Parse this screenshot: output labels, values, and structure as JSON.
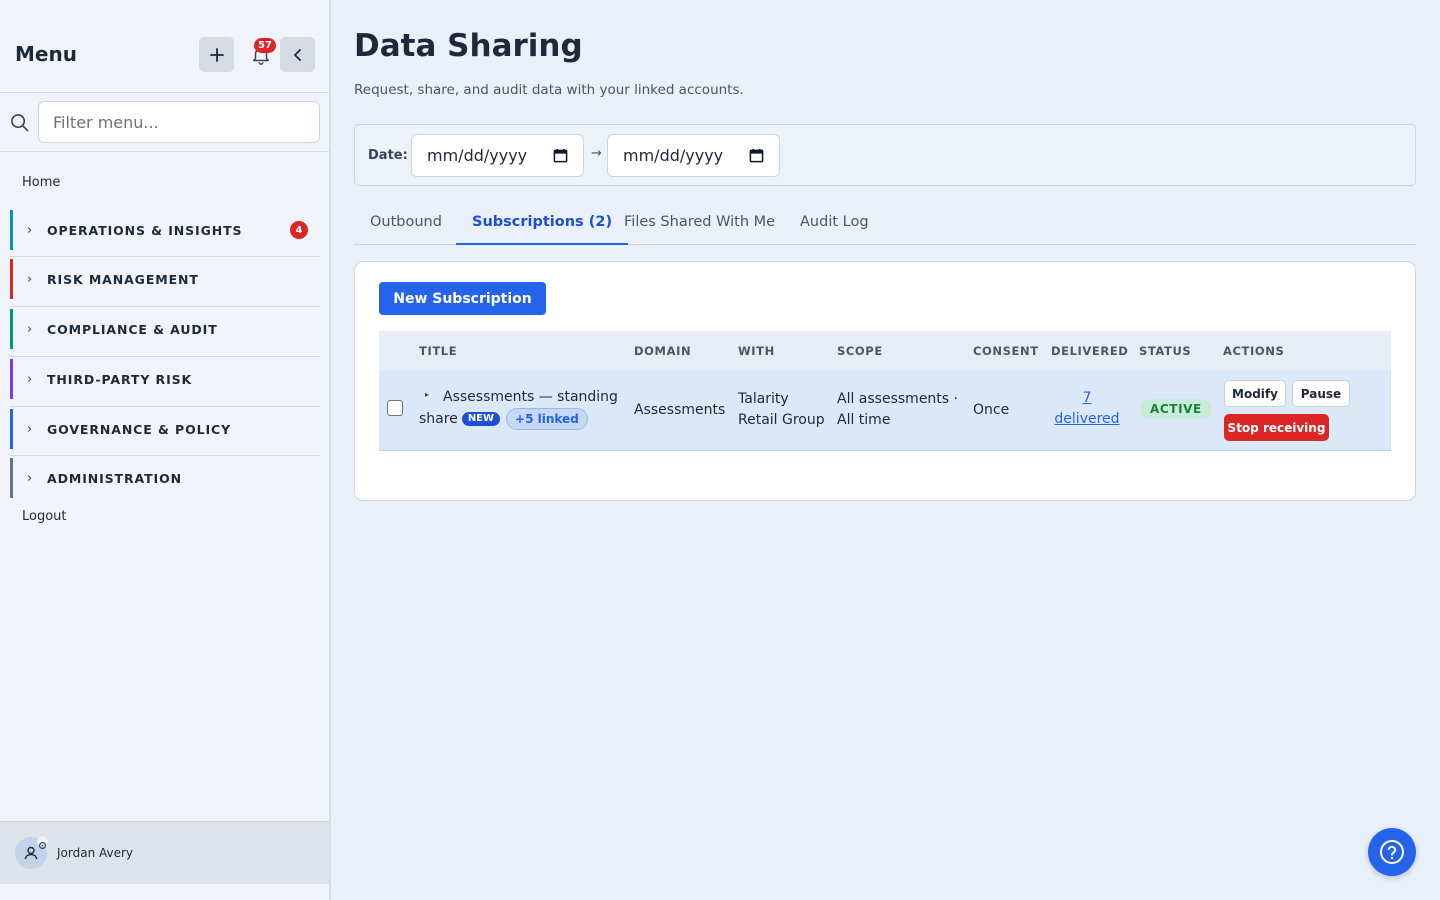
{
  "sidebar": {
    "title": "Menu",
    "notification_count": "57",
    "filter_placeholder": "Filter menu...",
    "home_label": "Home",
    "logout_label": "Logout",
    "sections": [
      {
        "label": "OPERATIONS & INSIGHTS",
        "count": "4",
        "color": "#0891b2"
      },
      {
        "label": "RISK MANAGEMENT",
        "color": "#dc2626"
      },
      {
        "label": "COMPLIANCE & AUDIT",
        "color": "#059669"
      },
      {
        "label": "THIRD-PARTY RISK",
        "color": "#7c3aed"
      },
      {
        "label": "GOVERNANCE & POLICY",
        "color": "#2563eb"
      },
      {
        "label": "ADMINISTRATION",
        "color": "#64748b"
      }
    ],
    "user_name": "Jordan Avery"
  },
  "main": {
    "title": "Data Sharing",
    "subtitle": "Request, share, and audit data with your linked accounts.",
    "filter": {
      "date_label": "Date:",
      "from_placeholder": "mm/dd/yyyy",
      "to_placeholder": "mm/dd/yyyy",
      "arrow": "→"
    },
    "tabs": [
      {
        "label": "Outbound"
      },
      {
        "label": "Subscriptions (2)"
      },
      {
        "label": "Files Shared With Me"
      },
      {
        "label": "Audit Log"
      }
    ],
    "new_button_label": "New Subscription",
    "table": {
      "columns": [
        "TITLE",
        "DOMAIN",
        "WITH",
        "SCOPE",
        "CONSENT",
        "DELIVERED",
        "STATUS",
        "ACTIONS"
      ],
      "rows": [
        {
          "title_line1": "Assessments — standing",
          "title_line2": "share",
          "new_badge": "NEW",
          "linked_badge": "+5 linked",
          "domain": "Assessments",
          "with_line1": "Talarity",
          "with_line2": "Retail Group",
          "scope_line1": "All assessments ·",
          "scope_line2": "All time",
          "consent": "Once",
          "delivered_count": "7",
          "delivered_label": "delivered",
          "status": "ACTIVE",
          "action_modify": "Modify",
          "action_pause": "Pause",
          "action_stop": "Stop receiving"
        }
      ]
    }
  },
  "colors": {
    "accent": "#2563eb",
    "danger": "#dc2626",
    "success": "#15803d"
  }
}
